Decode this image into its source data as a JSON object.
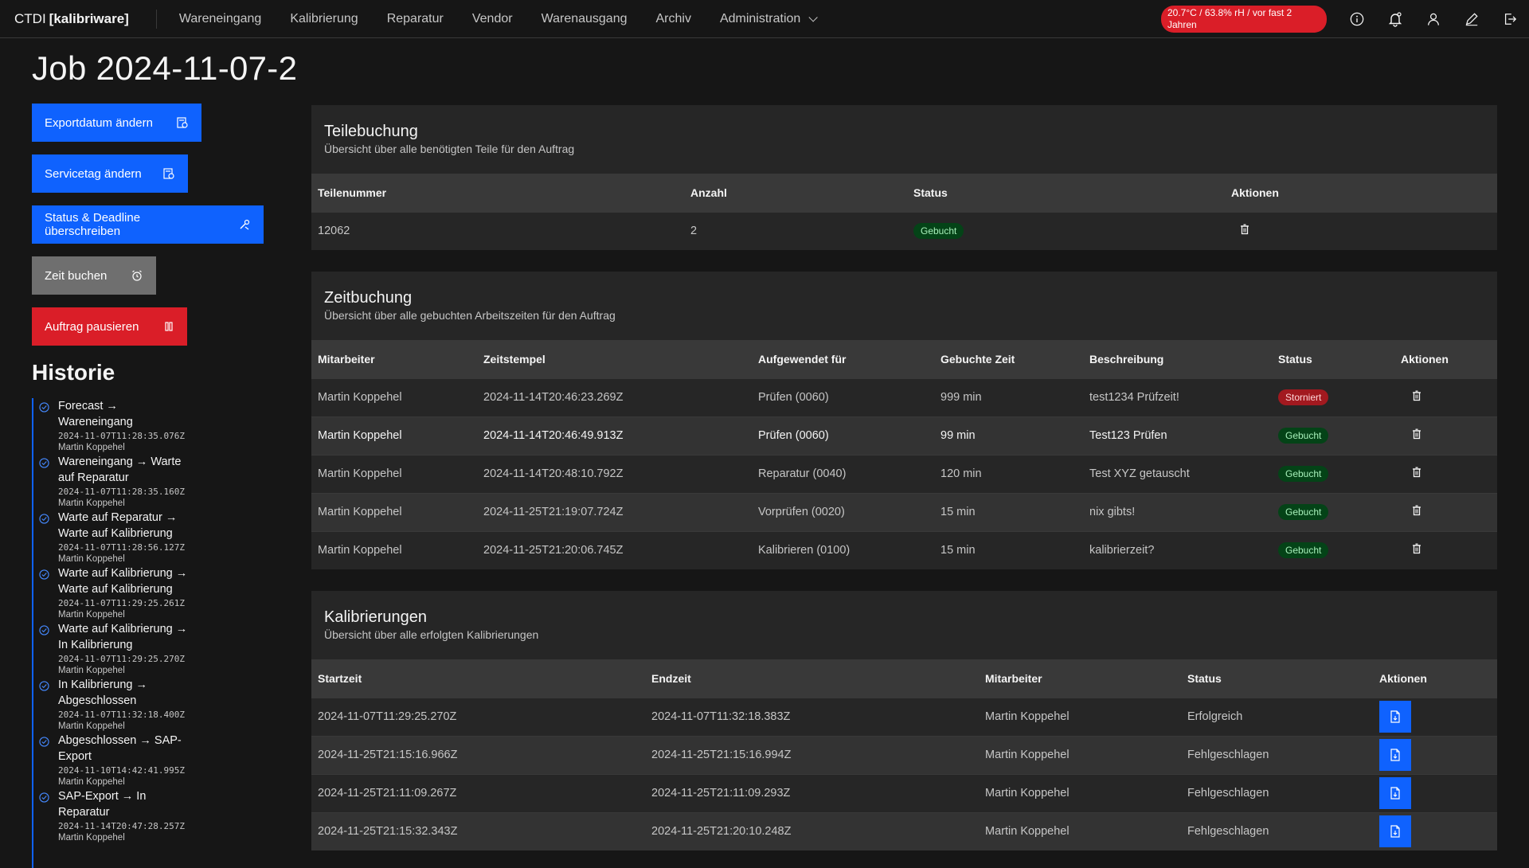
{
  "header": {
    "brand_prefix": "CTDI",
    "brand_name": "[kalibriware]",
    "nav": [
      "Wareneingang",
      "Kalibrierung",
      "Reparatur",
      "Vendor",
      "Warenausgang",
      "Archiv",
      "Administration"
    ],
    "env_tag": "20.7°C / 63.8% rH / vor fast 2 Jahren",
    "icons": [
      "info-icon",
      "notification-icon",
      "user-icon",
      "edit-icon",
      "logout-icon"
    ]
  },
  "page": {
    "title": "Job 2024-11-07-2"
  },
  "actions": {
    "export_date": "Exportdatum ändern",
    "servicetag": "Servicetag ändern",
    "status_deadline": "Status & Deadline überschreiben",
    "book_time": "Zeit buchen",
    "pause": "Auftrag pausieren"
  },
  "historie": {
    "title": "Historie",
    "items": [
      {
        "label": "Forecast → Wareneingang",
        "time": "2024-11-07T11:28:35.076Z",
        "user": "Martin Koppehel"
      },
      {
        "label": "Wareneingang → Warte auf Reparatur",
        "time": "2024-11-07T11:28:35.160Z",
        "user": "Martin Koppehel"
      },
      {
        "label": "Warte auf Reparatur → Warte auf Kalibrierung",
        "time": "2024-11-07T11:28:56.127Z",
        "user": "Martin Koppehel"
      },
      {
        "label": "Warte auf Kalibrierung → Warte auf Kalibrierung",
        "time": "2024-11-07T11:29:25.261Z",
        "user": "Martin Koppehel"
      },
      {
        "label": "Warte auf Kalibrierung → In Kalibrierung",
        "time": "2024-11-07T11:29:25.270Z",
        "user": "Martin Koppehel"
      },
      {
        "label": "In Kalibrierung → Abgeschlossen",
        "time": "2024-11-07T11:32:18.400Z",
        "user": "Martin Koppehel"
      },
      {
        "label": "Abgeschlossen → SAP-Export",
        "time": "2024-11-10T14:42:41.995Z",
        "user": "Martin Koppehel"
      },
      {
        "label": "SAP-Export → In Reparatur",
        "time": "2024-11-14T20:47:28.257Z",
        "user": "Martin Koppehel"
      }
    ]
  },
  "teilebuchung": {
    "title": "Teilebuchung",
    "subtitle": "Übersicht über alle benötigten Teile für den Auftrag",
    "columns": [
      "Teilenummer",
      "Anzahl",
      "Status",
      "Aktionen"
    ],
    "rows": [
      {
        "teilenummer": "12062",
        "anzahl": "2",
        "status": "Gebucht"
      }
    ]
  },
  "zeitbuchung": {
    "title": "Zeitbuchung",
    "subtitle": "Übersicht über alle gebuchten Arbeitszeiten für den Auftrag",
    "columns": [
      "Mitarbeiter",
      "Zeitstempel",
      "Aufgewendet für",
      "Gebuchte Zeit",
      "Beschreibung",
      "Status",
      "Aktionen"
    ],
    "rows": [
      {
        "mitarbeiter": "Martin Koppehel",
        "zeitstempel": "2024-11-14T20:46:23.269Z",
        "fuer": "Prüfen (0060)",
        "zeit": "999 min",
        "beschreibung": "test1234 Prüfzeit!",
        "status": "Storniert"
      },
      {
        "mitarbeiter": "Martin Koppehel",
        "zeitstempel": "2024-11-14T20:46:49.913Z",
        "fuer": "Prüfen (0060)",
        "zeit": "99 min",
        "beschreibung": "Test123 Prüfen",
        "status": "Gebucht"
      },
      {
        "mitarbeiter": "Martin Koppehel",
        "zeitstempel": "2024-11-14T20:48:10.792Z",
        "fuer": "Reparatur (0040)",
        "zeit": "120 min",
        "beschreibung": "Test XYZ getauscht",
        "status": "Gebucht"
      },
      {
        "mitarbeiter": "Martin Koppehel",
        "zeitstempel": "2024-11-25T21:19:07.724Z",
        "fuer": "Vorprüfen (0020)",
        "zeit": "15 min",
        "beschreibung": "nix gibts!",
        "status": "Gebucht"
      },
      {
        "mitarbeiter": "Martin Koppehel",
        "zeitstempel": "2024-11-25T21:20:06.745Z",
        "fuer": "Kalibrieren (0100)",
        "zeit": "15 min",
        "beschreibung": "kalibrierzeit?",
        "status": "Gebucht"
      }
    ]
  },
  "kalibrierungen": {
    "title": "Kalibrierungen",
    "subtitle": "Übersicht über alle erfolgten Kalibrierungen",
    "columns": [
      "Startzeit",
      "Endzeit",
      "Mitarbeiter",
      "Status",
      "Aktionen"
    ],
    "rows": [
      {
        "start": "2024-11-07T11:29:25.270Z",
        "end": "2024-11-07T11:32:18.383Z",
        "mitarbeiter": "Martin Koppehel",
        "status": "Erfolgreich"
      },
      {
        "start": "2024-11-25T21:15:16.966Z",
        "end": "2024-11-25T21:15:16.994Z",
        "mitarbeiter": "Martin Koppehel",
        "status": "Fehlgeschlagen"
      },
      {
        "start": "2024-11-25T21:11:09.267Z",
        "end": "2024-11-25T21:11:09.293Z",
        "mitarbeiter": "Martin Koppehel",
        "status": "Fehlgeschlagen"
      },
      {
        "start": "2024-11-25T21:15:32.343Z",
        "end": "2024-11-25T21:20:10.248Z",
        "mitarbeiter": "Martin Koppehel",
        "status": "Fehlgeschlagen"
      }
    ]
  }
}
